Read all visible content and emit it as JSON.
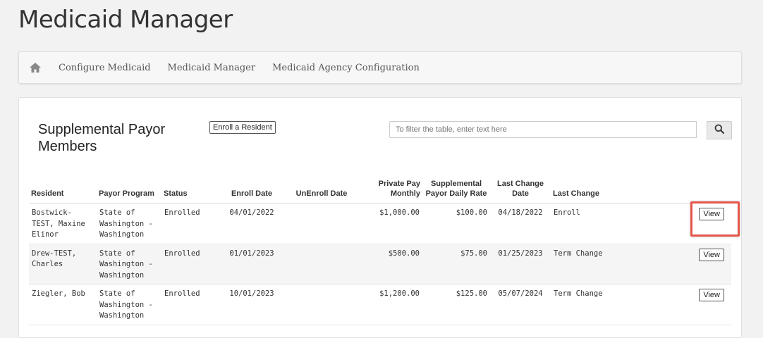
{
  "page": {
    "title": "Medicaid Manager"
  },
  "nav": {
    "home_icon": "home-icon",
    "items": [
      {
        "label": "Configure Medicaid"
      },
      {
        "label": "Medicaid Manager"
      },
      {
        "label": "Medicaid Agency Configuration"
      }
    ]
  },
  "panel": {
    "title": "Supplemental Payor Members",
    "enroll_label": "Enroll a Resident",
    "filter_placeholder": "To filter the table, enter text here",
    "search_icon": "search-icon"
  },
  "table": {
    "headers": {
      "resident": "Resident",
      "program": "Payor Program",
      "status": "Status",
      "enroll": "Enroll Date",
      "unenroll": "UnEnroll Date",
      "private": "Private Pay Monthly",
      "supp": "Supplemental Payor Daily Rate",
      "last_date": "Last Change Date",
      "last_change": "Last Change"
    },
    "rows": [
      {
        "resident": "Bostwick-TEST, Maxine Elinor",
        "program": "State of Washington - Washington",
        "status": "Enrolled",
        "enroll": "04/01/2022",
        "unenroll": "",
        "private": "$1,000.00",
        "supp": "$100.00",
        "last_date": "04/18/2022",
        "last_change": "Enroll",
        "action": "View"
      },
      {
        "resident": "Drew-TEST, Charles",
        "program": "State of Washington - Washington",
        "status": "Enrolled",
        "enroll": "01/01/2023",
        "unenroll": "",
        "private": "$500.00",
        "supp": "$75.00",
        "last_date": "01/25/2023",
        "last_change": "Term Change",
        "action": "View"
      },
      {
        "resident": "Ziegler, Bob",
        "program": "State of Washington - Washington",
        "status": "Enrolled",
        "enroll": "10/01/2023",
        "unenroll": "",
        "private": "$1,200.00",
        "supp": "$125.00",
        "last_date": "05/07/2024",
        "last_change": "Term Change",
        "action": "View"
      }
    ]
  },
  "colors": {
    "highlight": "#e5574a"
  }
}
